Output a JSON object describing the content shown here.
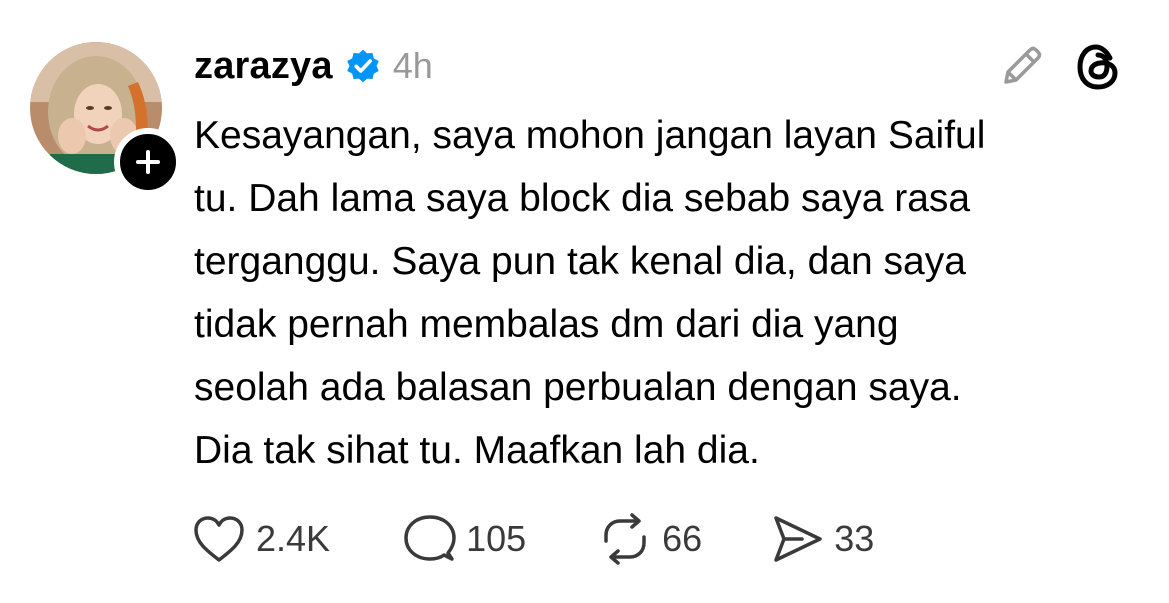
{
  "post": {
    "author": {
      "username": "zarazya",
      "verified": true,
      "avatar_icon": "profile-photo-hijab"
    },
    "timestamp": "4h",
    "text": "Kesayangan, saya mohon jangan layan Saiful\ntu. Dah lama saya block dia sebab saya rasa\nterganggu. Saya pun tak kenal dia, dan saya\ntidak pernah membalas dm dari dia yang\nseolah ada balasan perbualan dengan saya.\nDia tak sihat tu. Maafkan lah dia.",
    "actions": {
      "likes": "2.4K",
      "replies": "105",
      "reposts": "66",
      "shares": "33"
    }
  },
  "icons": {
    "follow": "plus-icon",
    "verified": "verified-badge-icon",
    "edit": "pencil-icon",
    "app": "threads-logo-icon",
    "like": "heart-icon",
    "reply": "comment-bubble-icon",
    "repost": "repost-arrows-icon",
    "share": "send-icon"
  },
  "colors": {
    "verified_blue": "#0095F6",
    "timestamp_gray": "#999999",
    "icon_gray": "#9A9A9A"
  }
}
